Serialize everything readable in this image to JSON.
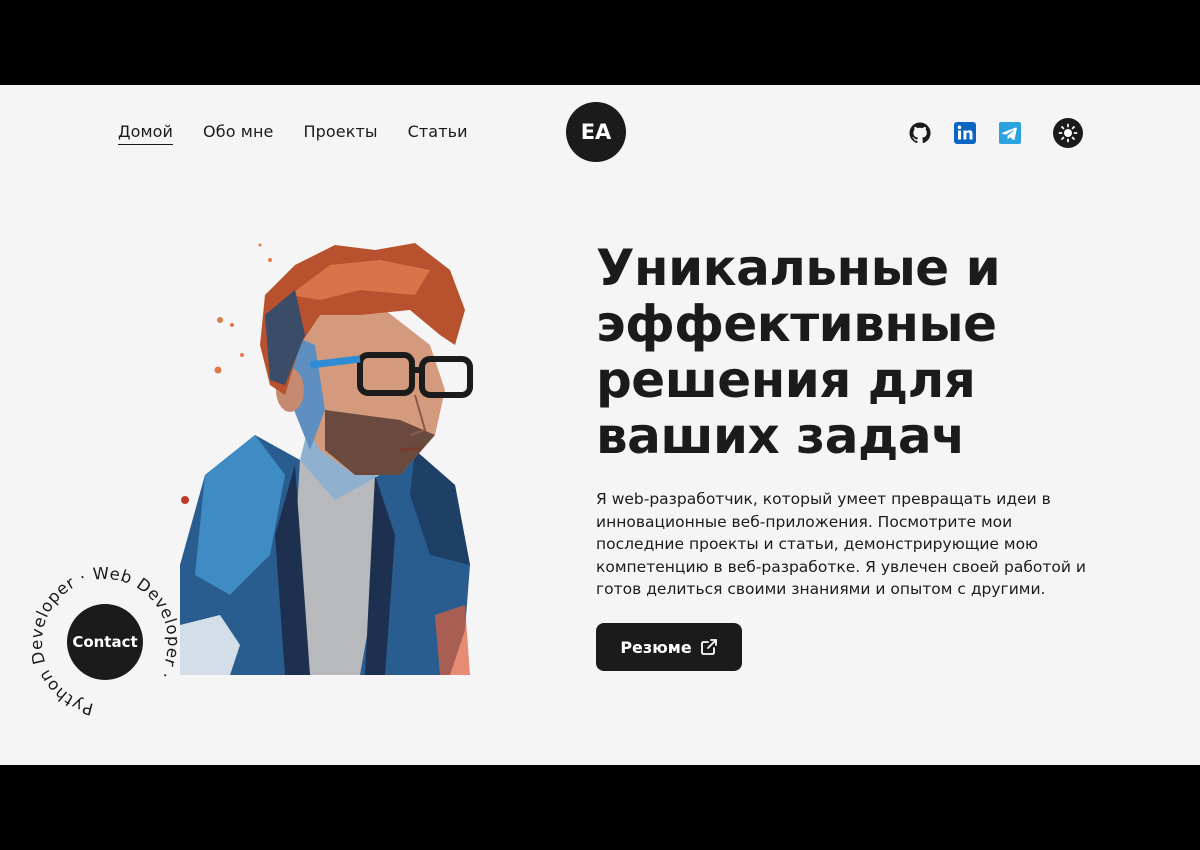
{
  "nav": {
    "items": [
      {
        "label": "Домой",
        "active": true
      },
      {
        "label": "Обо мне",
        "active": false
      },
      {
        "label": "Проекты",
        "active": false
      },
      {
        "label": "Статьи",
        "active": false
      }
    ]
  },
  "logo": {
    "text": "EA"
  },
  "socials": [
    {
      "name": "github-icon"
    },
    {
      "name": "linkedin-icon"
    },
    {
      "name": "telegram-icon"
    },
    {
      "name": "theme-toggle-sun-icon"
    }
  ],
  "hero": {
    "title_lines": [
      "Уникальные и",
      "эффективные",
      "решения для",
      "ваших задач"
    ],
    "description": "Я web-разработчик, который умеет превращать идеи в инновационные веб-приложения. Посмотрите мои последние проекты и статьи, демонстрирующие мою компетенцию в веб-разработке. Я увлечен своей работой и готов делиться своими знаниями и опытом с другими.",
    "resume_label": "Резюме"
  },
  "badge": {
    "circle_text": "Python Developer · Web Developer ·",
    "contact_label": "Contact"
  },
  "colors": {
    "background": "#f5f5f5",
    "dark": "#1b1b1b",
    "letterbox": "#000000",
    "linkedin": "#0a66c2",
    "telegram": "#2aa3df"
  }
}
